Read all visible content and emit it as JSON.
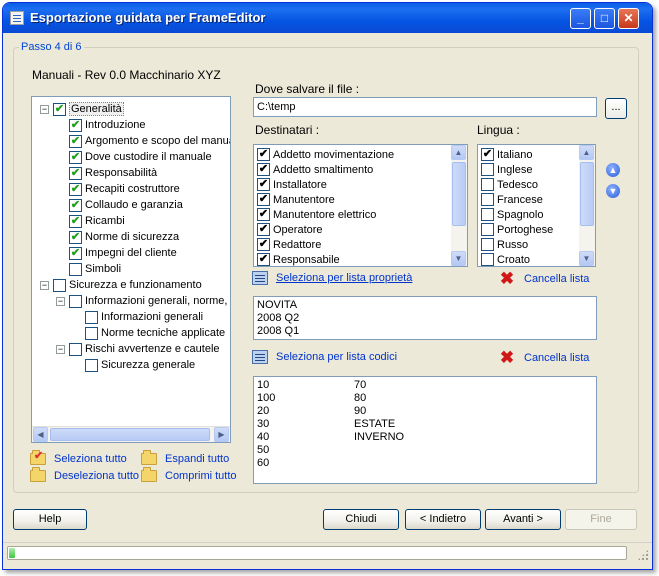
{
  "window": {
    "title": "Esportazione guidata per FrameEditor",
    "minimize_symbol": "_",
    "maximize_symbol": "□",
    "close_symbol": "✕"
  },
  "step_label": "Passo 4 di 6",
  "manual_title": "Manuali - Rev 0.0 Macchinario XYZ",
  "tree": {
    "nodes": [
      {
        "label": "Generalità",
        "checked": true,
        "level": 0,
        "expander": "−"
      },
      {
        "label": "Introduzione",
        "checked": true,
        "level": 1
      },
      {
        "label": "Argomento e scopo del manuale",
        "checked": true,
        "level": 1
      },
      {
        "label": "Dove custodire il manuale",
        "checked": true,
        "level": 1
      },
      {
        "label": "Responsabilità",
        "checked": true,
        "level": 1
      },
      {
        "label": "Recapiti costruttore",
        "checked": true,
        "level": 1
      },
      {
        "label": "Collaudo e garanzia",
        "checked": true,
        "level": 1
      },
      {
        "label": "Ricambi",
        "checked": true,
        "level": 1
      },
      {
        "label": "Norme di sicurezza",
        "checked": true,
        "level": 1
      },
      {
        "label": "Impegni del cliente",
        "checked": true,
        "level": 1
      },
      {
        "label": "Simboli",
        "checked": false,
        "level": 1
      },
      {
        "label": "Sicurezza e funzionamento",
        "checked": false,
        "level": 0,
        "expander": "−"
      },
      {
        "label": "Informazioni generali, norme, direttive",
        "checked": false,
        "level": 1,
        "expander": "−"
      },
      {
        "label": "Informazioni generali",
        "checked": false,
        "level": 2
      },
      {
        "label": "Norme tecniche applicate",
        "checked": false,
        "level": 2
      },
      {
        "label": "Rischi avvertenze e cautele",
        "checked": false,
        "level": 1,
        "expander": "−"
      },
      {
        "label": "Sicurezza generale",
        "checked": false,
        "level": 2
      }
    ],
    "actions": {
      "select_all": "Seleziona tutto",
      "deselect_all": "Deseleziona tutto",
      "expand_all": "Espandi tutto",
      "collapse_all": "Comprimi tutto"
    }
  },
  "save_location": {
    "label": "Dove salvare il file :",
    "value": "C:\\temp",
    "browse_label": "..."
  },
  "recipients": {
    "label": "Destinatari :",
    "items": [
      {
        "label": "Addetto movimentazione",
        "checked": true
      },
      {
        "label": "Addetto smaltimento",
        "checked": true
      },
      {
        "label": "Installatore",
        "checked": true
      },
      {
        "label": "Manutentore",
        "checked": true
      },
      {
        "label": "Manutentore elettrico",
        "checked": true
      },
      {
        "label": "Operatore",
        "checked": true
      },
      {
        "label": "Redattore",
        "checked": true
      },
      {
        "label": "Responsabile",
        "checked": true
      }
    ]
  },
  "languages": {
    "label": "Lingua :",
    "items": [
      {
        "label": "Italiano",
        "checked": true
      },
      {
        "label": "Inglese",
        "checked": false
      },
      {
        "label": "Tedesco",
        "checked": false
      },
      {
        "label": "Francese",
        "checked": false
      },
      {
        "label": "Spagnolo",
        "checked": false
      },
      {
        "label": "Portoghese",
        "checked": false
      },
      {
        "label": "Russo",
        "checked": false
      },
      {
        "label": "Croato",
        "checked": false
      }
    ]
  },
  "property_filter": {
    "select_label": "Seleziona per lista proprietà",
    "clear_label": "Cancella lista",
    "items": [
      "NOVITA",
      "2008 Q2",
      "2008 Q1"
    ]
  },
  "code_filter": {
    "select_label": "Seleziona per lista codici",
    "clear_label": "Cancella lista",
    "col1": [
      "10",
      "100",
      "20",
      "30",
      "40",
      "50",
      "60"
    ],
    "col2": [
      "70",
      "80",
      "90",
      "ESTATE",
      "INVERNO"
    ]
  },
  "buttons": {
    "help": "Help",
    "close": "Chiudi",
    "back": "< Indietro",
    "next": "Avanti >",
    "finish": "Fine"
  },
  "progress": 0.01,
  "colors": {
    "title_bar": "#0a5ee6",
    "link": "#0033cc",
    "step_label": "#0046d5",
    "check": "#21a121"
  }
}
